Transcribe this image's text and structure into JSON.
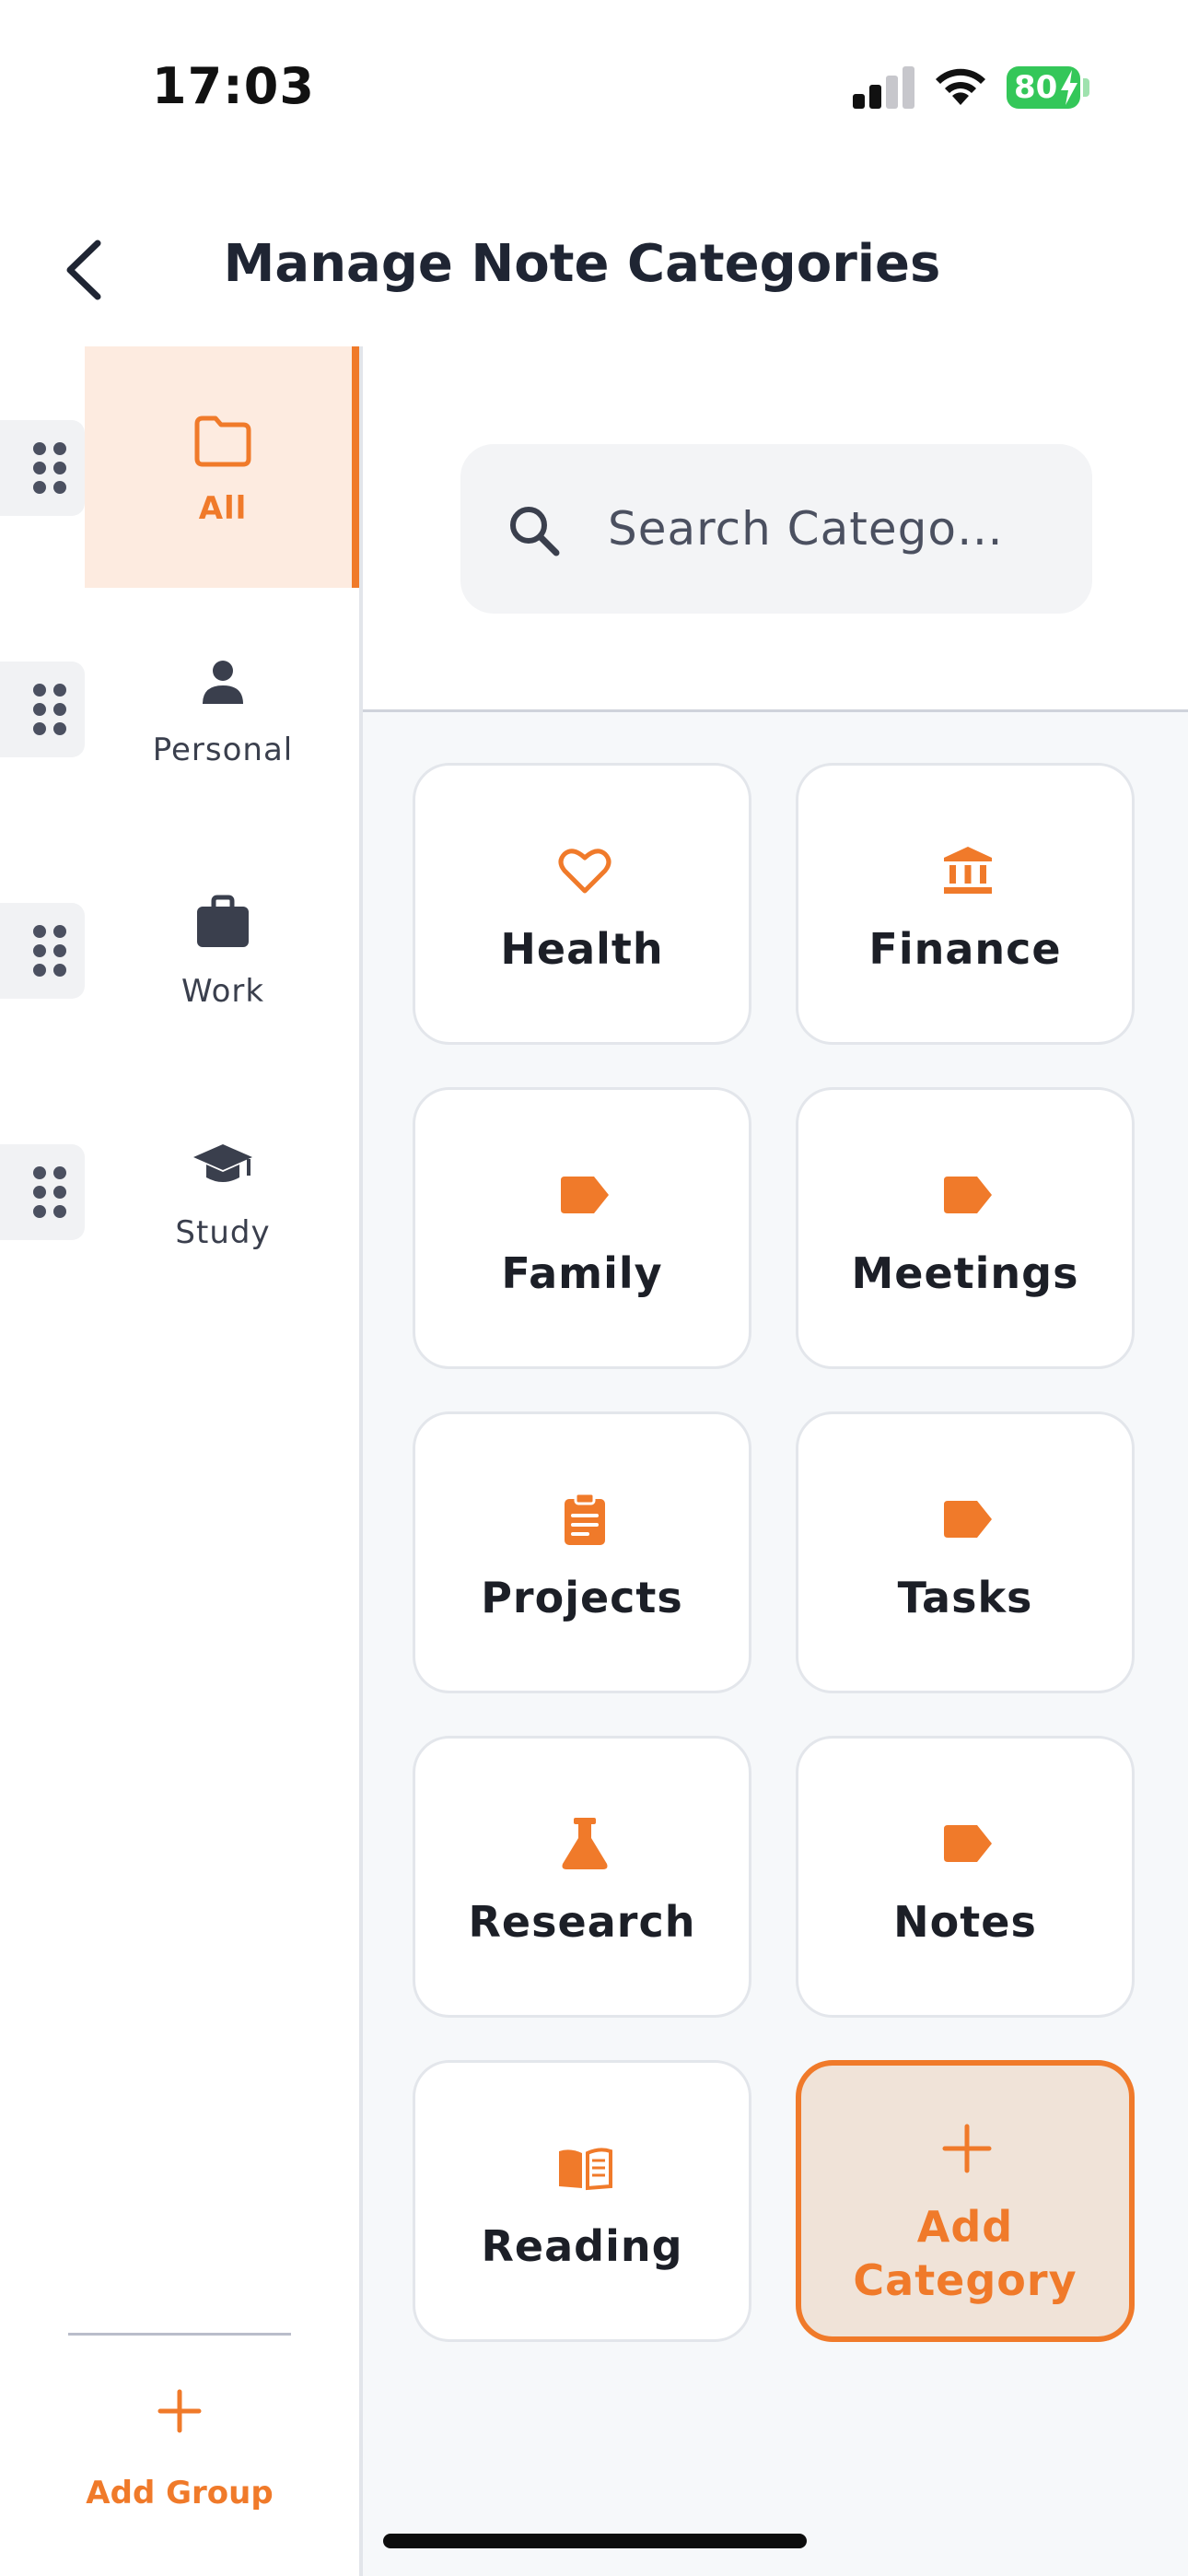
{
  "status_bar": {
    "time": "17:03",
    "battery_level": "80",
    "icons": [
      "cellular-signal-icon",
      "wifi-icon",
      "battery-icon",
      "charging-bolt-icon"
    ]
  },
  "header": {
    "title": "Manage Note Categories",
    "back_icon": "chevron-left-icon"
  },
  "sidebar": {
    "groups": [
      {
        "label": "All",
        "icon": "folder-icon",
        "active": true
      },
      {
        "label": "Personal",
        "icon": "person-icon",
        "active": false
      },
      {
        "label": "Work",
        "icon": "briefcase-icon",
        "active": false
      },
      {
        "label": "Study",
        "icon": "graduation-cap-icon",
        "active": false
      }
    ],
    "add_group_label": "Add Group"
  },
  "search": {
    "placeholder": "Search Catego…",
    "value": ""
  },
  "categories": [
    {
      "label": "Health",
      "icon": "heart-icon"
    },
    {
      "label": "Finance",
      "icon": "bank-icon"
    },
    {
      "label": "Family",
      "icon": "tag-icon"
    },
    {
      "label": "Meetings",
      "icon": "tag-icon"
    },
    {
      "label": "Projects",
      "icon": "clipboard-icon"
    },
    {
      "label": "Tasks",
      "icon": "tag-icon"
    },
    {
      "label": "Research",
      "icon": "flask-icon"
    },
    {
      "label": "Notes",
      "icon": "tag-icon"
    },
    {
      "label": "Reading",
      "icon": "open-book-icon"
    }
  ],
  "add_category": {
    "line1": "Add",
    "line2": "Category"
  },
  "colors": {
    "accent": "#f07a2a",
    "active_bg": "#fdebe0",
    "add_card_bg": "#f0e3d8",
    "text": "#1f2533",
    "battery": "#34c759"
  }
}
